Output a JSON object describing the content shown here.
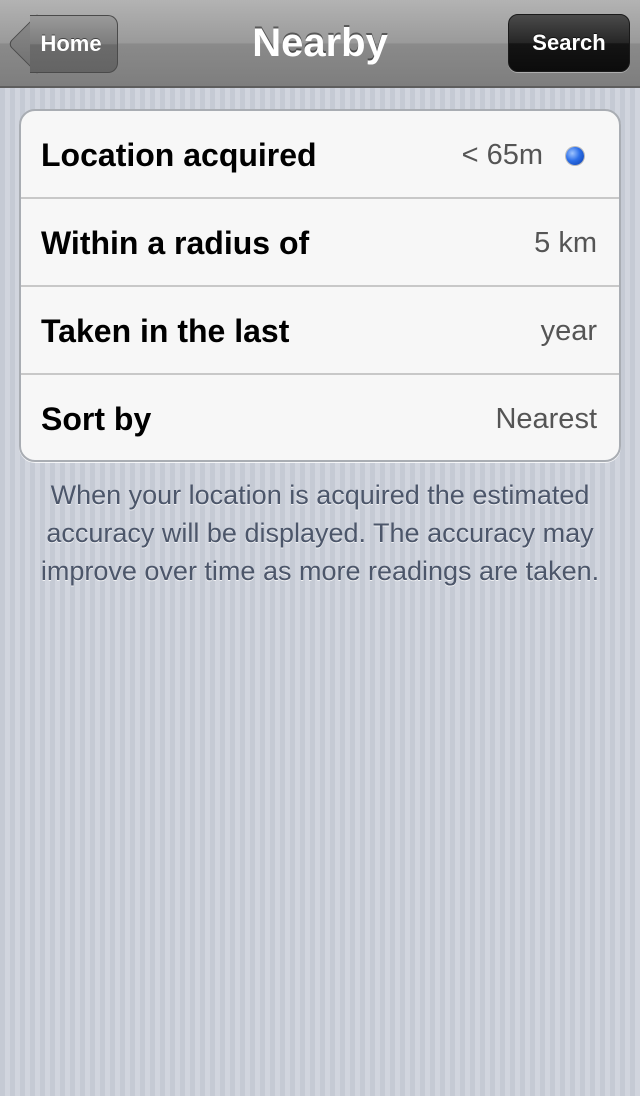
{
  "navbar": {
    "title": "Nearby",
    "back_label": "Home",
    "search_label": "Search"
  },
  "settings": {
    "rows": [
      {
        "label": "Location acquired",
        "value": "< 65m",
        "indicator": "location-dot-icon"
      },
      {
        "label": "Within a radius of",
        "value": "5 km"
      },
      {
        "label": "Taken in the last",
        "value": "year"
      },
      {
        "label": "Sort by",
        "value": "Nearest"
      }
    ]
  },
  "footer": {
    "note": "When your location is acquired the estimated accuracy will be displayed. The accuracy may improve over time as more readings are taken."
  },
  "colors": {
    "location_dot": "#2d6fe8",
    "navbar": "#8a8a8a",
    "search_button": "#141414"
  }
}
